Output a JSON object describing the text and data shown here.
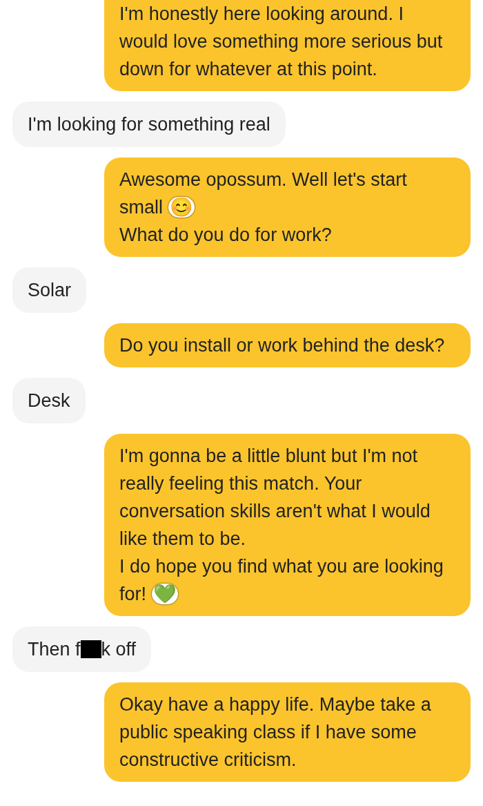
{
  "messages": [
    {
      "kind": "sent",
      "text": "I'm honestly here looking around. I would love something more serious but down for whatever at this point."
    },
    {
      "kind": "received",
      "text": "I'm looking for something real"
    },
    {
      "kind": "sent",
      "text": "Awesome opossum. Well let's start small",
      "emoji": "😊",
      "text_after": "What do you do for work?"
    },
    {
      "kind": "received",
      "text": "Solar"
    },
    {
      "kind": "sent",
      "text": "Do you install or work behind the desk?"
    },
    {
      "kind": "received",
      "text": "Desk"
    },
    {
      "kind": "sent",
      "text": "I'm gonna be a little blunt but I'm not really feeling this match. Your conversation skills aren't what I would like them to be.\nI do hope you find what you are looking for!",
      "emoji": "💚"
    },
    {
      "kind": "received",
      "text": "Then f",
      "redacted": true,
      "text_after": "k off"
    },
    {
      "kind": "sent",
      "text": "Okay have a happy life. Maybe take a public speaking class if I have some constructive criticism."
    }
  ]
}
